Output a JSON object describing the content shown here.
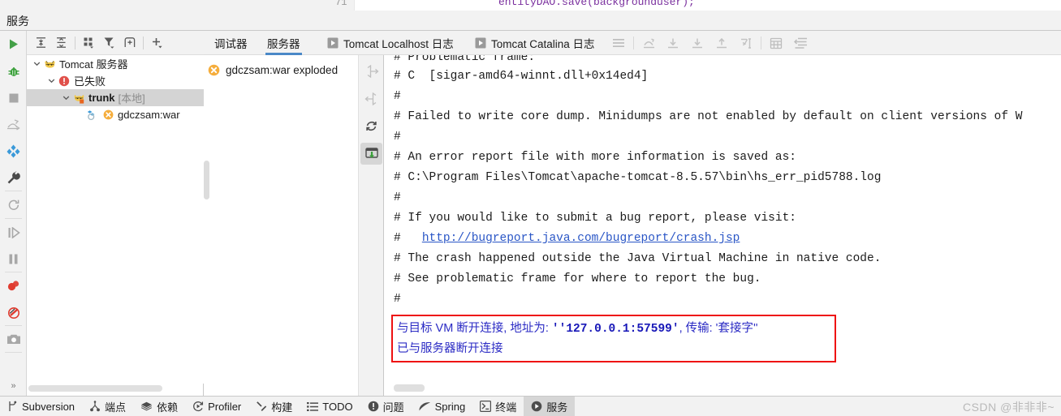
{
  "editor_sliver": {
    "line_number": "71",
    "code": "entityDAO.save(backgrounduser);"
  },
  "window": {
    "title": "服务"
  },
  "run_rail": {
    "buttons": [
      {
        "name": "run-button",
        "icon": "play-icon",
        "tooltip": "运行"
      },
      {
        "name": "debug-button",
        "icon": "bug-icon",
        "tooltip": "调试"
      },
      {
        "name": "stop-button",
        "icon": "stop-square-icon",
        "tooltip": "停止"
      },
      {
        "name": "step-over-button",
        "icon": "step-over-icon",
        "tooltip": "步过"
      },
      {
        "name": "modules-button",
        "icon": "four-diamonds-icon",
        "tooltip": "模块"
      },
      {
        "name": "settings-button",
        "icon": "wrench-icon",
        "tooltip": "设置"
      },
      {
        "name": "rerun-button",
        "icon": "rerun-circle-arrow-icon",
        "tooltip": "重新运行"
      },
      {
        "name": "resume-button",
        "icon": "resume-program-icon",
        "tooltip": "恢复程序"
      },
      {
        "name": "pause-button",
        "icon": "pause-icon",
        "tooltip": "暂停"
      },
      {
        "name": "view-breakpoints-button",
        "icon": "breakpoints-icon",
        "tooltip": "查看断点"
      },
      {
        "name": "mute-breakpoints-button",
        "icon": "mute-breakpoints-icon",
        "tooltip": "静音断点"
      },
      {
        "name": "screenshot-button",
        "icon": "camera-icon",
        "tooltip": "截图"
      }
    ],
    "overflow_label": "»"
  },
  "tree_panel": {
    "toolbar": [
      {
        "name": "expand-all-button",
        "icon": "expand-all-icon"
      },
      {
        "name": "collapse-all-button",
        "icon": "collapse-all-icon"
      },
      {
        "name": "group-by-button",
        "icon": "group-by-icon"
      },
      {
        "name": "filter-button",
        "icon": "filter-icon"
      },
      {
        "name": "add-tab-button",
        "icon": "add-tab-icon"
      },
      {
        "name": "add-service-button",
        "icon": "plus-icon"
      }
    ],
    "nodes": [
      {
        "label": "Tomcat 服务器",
        "sub": "",
        "depth": 0,
        "icon": "tomcat-icon",
        "expanded": true,
        "selected": false,
        "status": "none"
      },
      {
        "label": "已失败",
        "sub": "",
        "depth": 1,
        "icon": "error-badge-icon",
        "expanded": true,
        "selected": false,
        "status": "failed"
      },
      {
        "label": "trunk",
        "sub": "[本地]",
        "depth": 2,
        "icon": "tomcat-run-icon",
        "expanded": true,
        "selected": true,
        "status": "none"
      },
      {
        "label": "gdczsam:war",
        "sub": "",
        "depth": 3,
        "icon": "artifact-icon",
        "expanded": false,
        "selected": false,
        "status": "error"
      }
    ]
  },
  "deploy_panel": {
    "item": {
      "label": "gdczsam:war exploded",
      "status_icon": "error-circle-x-icon"
    },
    "side_buttons": [
      {
        "name": "expand-deployment-button",
        "icon": "arrow-expand-right-icon",
        "active": false
      },
      {
        "name": "collapse-deployment-button",
        "icon": "arrow-collapse-left-icon",
        "active": false
      },
      {
        "name": "redeploy-button",
        "icon": "refresh-icon",
        "active": false
      },
      {
        "name": "deploy-download-button",
        "icon": "deploy-down-icon",
        "active": true
      }
    ]
  },
  "tabs": [
    {
      "label": "调试器",
      "icon": "",
      "active": false
    },
    {
      "label": "服务器",
      "icon": "",
      "active": true
    },
    {
      "label": "Tomcat Localhost 日志",
      "icon": "console-run-icon",
      "active": false
    },
    {
      "label": "Tomcat Catalina 日志",
      "icon": "console-run-icon",
      "active": false
    }
  ],
  "tab_tools": [
    {
      "name": "menu-button",
      "icon": "hamburger-icon"
    },
    {
      "name": "step-out-button",
      "icon": "step-out-icon"
    },
    {
      "name": "step-over-toolbar-button",
      "icon": "step-over-down-icon"
    },
    {
      "name": "step-into-button",
      "icon": "step-into-down-icon"
    },
    {
      "name": "force-step-out-button",
      "icon": "force-step-up-icon"
    },
    {
      "name": "run-to-cursor-button",
      "icon": "run-to-cursor-icon"
    },
    {
      "name": "evaluate-expression-button",
      "icon": "calculator-icon"
    },
    {
      "name": "soft-wrap-button",
      "icon": "soft-wrap-icon"
    }
  ],
  "console": {
    "lines": [
      {
        "text": "# Problematic frame:",
        "clipped_top": true
      },
      {
        "text": "# C  [sigar-amd64-winnt.dll+0x14ed4]"
      },
      {
        "text": "#"
      },
      {
        "text": "# Failed to write core dump. Minidumps are not enabled by default on client versions of W"
      },
      {
        "text": "#"
      },
      {
        "text": "# An error report file with more information is saved as:"
      },
      {
        "text": "# C:\\Program Files\\Tomcat\\apache-tomcat-8.5.57\\bin\\hs_err_pid5788.log"
      },
      {
        "text": "#"
      },
      {
        "text": "# If you would like to submit a bug report, please visit:"
      },
      {
        "text": "#   ",
        "link": "http://bugreport.java.com/bugreport/crash.jsp"
      },
      {
        "text": "# The crash happened outside the Java Virtual Machine in native code."
      },
      {
        "text": "# See problematic frame for where to report the bug."
      },
      {
        "text": "#"
      }
    ],
    "highlight": {
      "line1_prefix": "与目标 VM 断开连接, 地址为: ",
      "line1_bold": "''127.0.0.1:57599'",
      "line1_suffix": ", 传输: '套接字''",
      "line2": "已与服务器断开连接",
      "border_color": "#ee1111",
      "text_color": "#2b2bc4"
    }
  },
  "statusbar": {
    "items": [
      {
        "label": "Subversion",
        "icon": "branch-icon",
        "active": false
      },
      {
        "label": "端点",
        "icon": "endpoints-icon",
        "active": false
      },
      {
        "label": "依赖",
        "icon": "layers-icon",
        "active": false
      },
      {
        "label": "Profiler",
        "icon": "profiler-icon",
        "active": false
      },
      {
        "label": "构建",
        "icon": "hammer-icon",
        "active": false
      },
      {
        "label": "TODO",
        "icon": "list-icon",
        "active": false
      },
      {
        "label": "问题",
        "icon": "warning-icon",
        "active": false
      },
      {
        "label": "Spring",
        "icon": "spring-leaf-icon",
        "active": false
      },
      {
        "label": "终端",
        "icon": "terminal-icon",
        "active": false
      },
      {
        "label": "服务",
        "icon": "services-play-icon",
        "active": true
      }
    ],
    "watermark": "CSDN @非非非~"
  },
  "colors": {
    "accent": "#4a88c7",
    "error": "#ee1111",
    "link": "#2a56c6",
    "selection": "#d4d4d4",
    "panel_bg": "#f2f2f2"
  }
}
